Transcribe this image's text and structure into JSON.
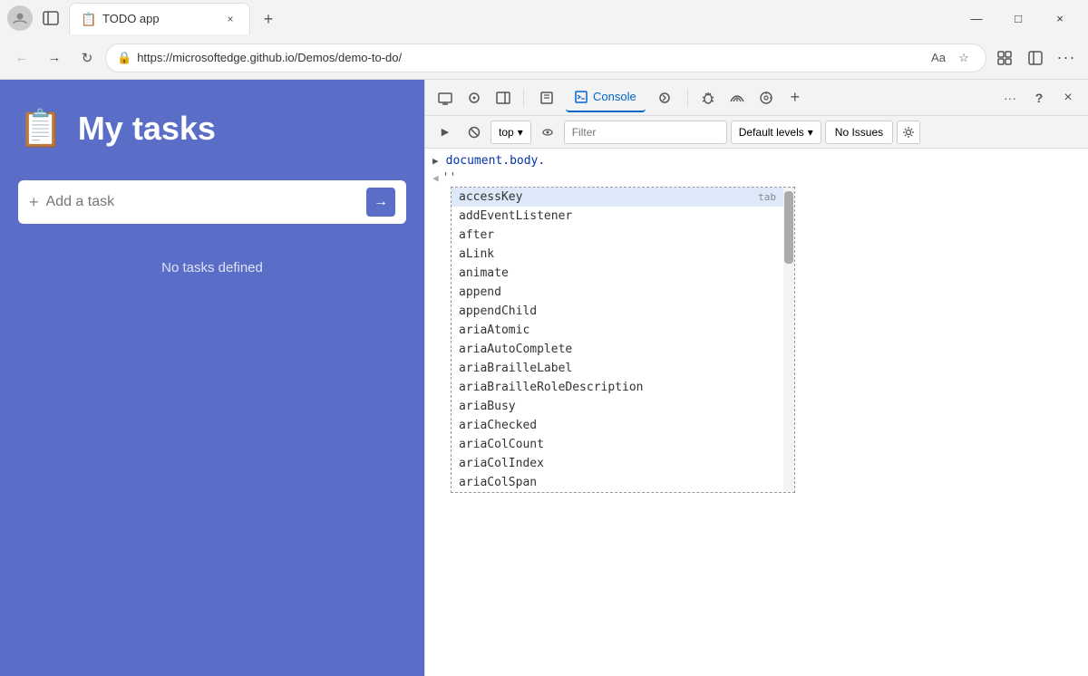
{
  "browser": {
    "tab": {
      "favicon": "📋",
      "title": "TODO app",
      "close_label": "×"
    },
    "new_tab_label": "+",
    "controls": {
      "minimize": "—",
      "maximize": "□",
      "close": "×"
    },
    "nav": {
      "back": "←",
      "forward": "→",
      "refresh": "↻",
      "url": "https://microsoftedge.github.io/Demos/demo-to-do/",
      "lock_icon": "🔒",
      "read_aloud": "Aa",
      "favorites": "☆",
      "collections": "⊞",
      "profile": "⚙",
      "more": "..."
    }
  },
  "app": {
    "icon": "📋",
    "title": "My tasks",
    "input_placeholder": "Add a task",
    "input_plus": "+",
    "submit_arrow": "→",
    "no_tasks_text": "No tasks defined"
  },
  "devtools": {
    "toolbar_tabs": [
      {
        "label": "Elements",
        "icon": "◻",
        "active": false
      },
      {
        "label": "Console",
        "icon": "⊡",
        "active": true
      },
      {
        "label": "Sources",
        "icon": "⬚",
        "active": false
      }
    ],
    "toolbar_icons": {
      "device": "📱",
      "responsive": "⊡",
      "sidebar": "⊞",
      "home": "⌂",
      "code": "</>",
      "bug": "🐞",
      "network": "📶",
      "settings": "⚙",
      "add": "+",
      "more": "...",
      "help": "?",
      "close": "×"
    },
    "console_toolbar": {
      "clear": "🚫",
      "top_dropdown": "top",
      "eye_icon": "👁",
      "filter_placeholder": "Filter",
      "levels_label": "Default levels",
      "levels_arrow": "▾",
      "no_issues": "No Issues",
      "settings_icon": "⚙"
    },
    "console_line": "document.body.",
    "console_cursor": "''",
    "autocomplete": {
      "items": [
        {
          "text": "accessKey",
          "hint": "tab"
        },
        {
          "text": "addEventListener",
          "hint": ""
        },
        {
          "text": "after",
          "hint": ""
        },
        {
          "text": "aLink",
          "hint": ""
        },
        {
          "text": "animate",
          "hint": ""
        },
        {
          "text": "append",
          "hint": ""
        },
        {
          "text": "appendChild",
          "hint": ""
        },
        {
          "text": "ariaAtomic",
          "hint": ""
        },
        {
          "text": "ariaAutoComplete",
          "hint": ""
        },
        {
          "text": "ariaBrailleLabel",
          "hint": ""
        },
        {
          "text": "ariaBrailleRoleDescription",
          "hint": ""
        },
        {
          "text": "ariaBusy",
          "hint": ""
        },
        {
          "text": "ariaChecked",
          "hint": ""
        },
        {
          "text": "ariaColCount",
          "hint": ""
        },
        {
          "text": "ariaColIndex",
          "hint": ""
        },
        {
          "text": "ariaColSpan",
          "hint": ""
        }
      ]
    }
  }
}
